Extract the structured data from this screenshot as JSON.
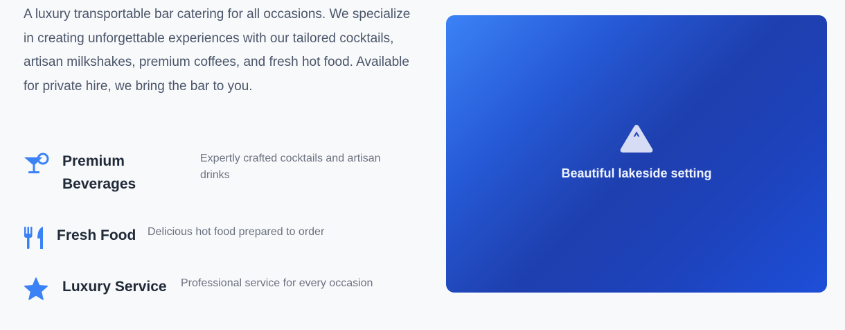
{
  "intro": {
    "text": "A luxury transportable bar catering for all occasions. We specialize in creating unforgettable experiences with our tailored cocktails, artisan milkshakes, premium coffees, and fresh hot food. Available for private hire, we bring the bar to you."
  },
  "features": [
    {
      "icon": "cocktail-icon",
      "title": "Premium Beverages",
      "description": "Expertly crafted cocktails and artisan drinks"
    },
    {
      "icon": "utensils-icon",
      "title": "Fresh Food",
      "description": "Delicious hot food prepared to order"
    },
    {
      "icon": "star-icon",
      "title": "Luxury Service",
      "description": "Professional service for every occasion"
    }
  ],
  "image_panel": {
    "icon": "mountain-icon",
    "caption": "Beautiful lakeside setting"
  },
  "colors": {
    "accent": "#3b82f6",
    "text_dark": "#1f2937",
    "text_body": "#4a5568",
    "text_muted": "#6b7280",
    "background": "#f8f9fb"
  }
}
